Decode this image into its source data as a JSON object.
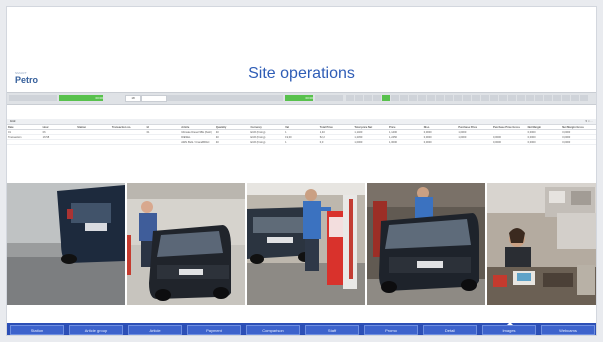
{
  "header": {
    "logo_small": "SMART",
    "logo": "Petro",
    "title": "Site operations"
  },
  "toolbar": {
    "green_left_value": "00:00",
    "field_value": "18",
    "green_mid_value": "00:00"
  },
  "grid": {
    "title": "Grid",
    "controls": "▼ × …",
    "columns": [
      "Date",
      "Hour",
      "Station",
      "Transaction no.",
      "Id",
      "Article",
      "Quantity",
      "Currency",
      "Vat",
      "Total Price",
      "Total price Net",
      "Price",
      "Disc.",
      "Purchase Price",
      "Purchase Price Gross",
      "Net Margin",
      "Net Margin Gross"
    ],
    "rows": [
      [
        "01",
        "06",
        "",
        "",
        "01",
        "Ultimate Diesel 95E (flush)",
        "40",
        "EUR (Fixing)",
        "1",
        "1,40",
        "1,1400",
        "1,1400",
        "0,0000",
        "1,0000",
        "",
        "0,0000",
        "0,0000"
      ],
      [
        "Transaction",
        "16:58",
        "",
        "",
        "",
        "DIESEL",
        "40",
        "EUR (Fixing)",
        "19,00",
        "52,2",
        "1,2450",
        "1,2450",
        "0,0000",
        "1,0000",
        "0,0000",
        "0,0000",
        "0,0000"
      ],
      [
        "",
        "",
        "",
        "",
        "",
        "AWG Bulk / CraneBRAC",
        "40",
        "EUR (Fixing)",
        "1",
        "0,0",
        "1,0000",
        "1,0000",
        "0,0000",
        "",
        "0,0000",
        "0,0000",
        "0,0000"
      ]
    ]
  },
  "photos": [
    {
      "name": "camera-1",
      "bg": "#8e8e8e"
    },
    {
      "name": "camera-2",
      "bg": "#c9c9c9"
    },
    {
      "name": "camera-3",
      "bg": "#a9a49b"
    },
    {
      "name": "camera-4",
      "bg": "#6b6258"
    },
    {
      "name": "camera-5",
      "bg": "#a89f94"
    }
  ],
  "nav": {
    "items": [
      "Station",
      "Article group",
      "Article",
      "Payment",
      "Comparison",
      "Staff",
      "Promo",
      "Detail",
      "Images",
      "Webcams"
    ],
    "active_index": 8
  },
  "colors": {
    "title": "#2f5db6",
    "toolbar_green": "#58c14d",
    "navbar": "#2c4fb6"
  }
}
